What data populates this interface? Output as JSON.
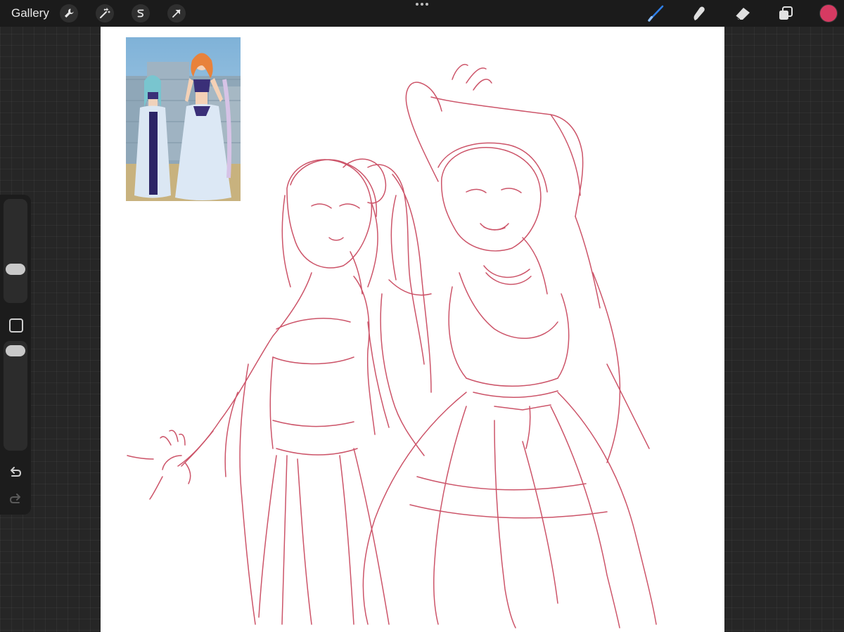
{
  "topbar": {
    "gallery_label": "Gallery",
    "left_tools": [
      {
        "icon": "wrench-icon",
        "name": "actions"
      },
      {
        "icon": "magic-wand-icon",
        "name": "adjustments"
      },
      {
        "icon": "selection-s-icon",
        "name": "selection"
      },
      {
        "icon": "arrow-cursor-icon",
        "name": "transform"
      }
    ],
    "right_tools": [
      {
        "icon": "brush-icon",
        "name": "paint",
        "active": true
      },
      {
        "icon": "smudge-icon",
        "name": "smudge"
      },
      {
        "icon": "eraser-icon",
        "name": "eraser"
      },
      {
        "icon": "layers-icon",
        "name": "layers"
      }
    ],
    "active_color": "#d63a62",
    "active_tool_color": "#2f7fe8"
  },
  "sidebar": {
    "brush_size": 0.28,
    "brush_opacity": 1.0,
    "modify_icon": "square-icon",
    "undo_icon": "undo-arrow-icon",
    "redo_icon": "redo-arrow-icon"
  },
  "canvas": {
    "background": "#ffffff",
    "sketch_color": "#c4374f",
    "reference_image": "reference-photo"
  }
}
